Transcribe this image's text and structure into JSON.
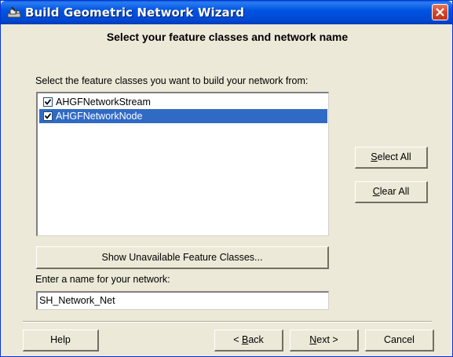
{
  "window": {
    "title": "Build Geometric Network Wizard",
    "app_icon": "network-wizard-icon",
    "close_icon": "close-icon"
  },
  "heading": "Select your feature classes and network name",
  "feature_prompt": "Select the feature classes you want to build your network from:",
  "feature_classes": [
    {
      "label": "AHGFNetworkStream",
      "checked": true,
      "selected": false
    },
    {
      "label": "AHGFNetworkNode",
      "checked": true,
      "selected": true
    }
  ],
  "buttons": {
    "select_all": {
      "mnemonic": "S",
      "rest": "elect All"
    },
    "clear_all": {
      "mnemonic": "C",
      "rest": "lear All"
    },
    "show_unavailable": "Show Unavailable Feature Classes...",
    "help": "Help",
    "back": {
      "prefix": "< ",
      "mnemonic": "B",
      "rest": "ack"
    },
    "next": {
      "mnemonic": "N",
      "rest": "ext >"
    },
    "cancel": "Cancel"
  },
  "network_name": {
    "label": "Enter a name for your network:",
    "value": "SH_Network_Net"
  },
  "colors": {
    "title_bar": "#0054e3",
    "dialog_bg": "#ece9d8",
    "selection": "#316ac5",
    "close_button": "#d2452a"
  }
}
